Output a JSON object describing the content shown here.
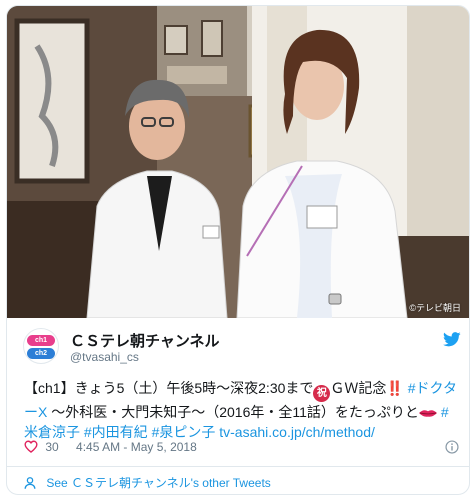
{
  "photo": {
    "watermark": "©テレビ朝日"
  },
  "avatar": {
    "top_badge": "ch1",
    "bottom_badge": "ch2"
  },
  "author": {
    "display_name": "ＣＳテレ朝チャンネル",
    "handle": "@tvasahi_cs"
  },
  "tweet": {
    "seg1": "【ch1】きょう5（土）午後5時～深夜2:30まで",
    "iwai_emoji": "祝",
    "seg2": "ＧＷ記念",
    "bang": "‼️",
    "hashtag1": "#ドクターX",
    "seg3": "～外科医・大門未知子～（2016年・全11話）をたっぷりと",
    "hashtags2": "#米倉涼子 #内田有紀 #泉ピン子",
    "link": "tv-asahi.co.jp/ch/method/"
  },
  "footer": {
    "likes": "30",
    "timestamp": "4:45 AM - May 5, 2018",
    "see_more": "See ＣＳテレ朝チャンネル's other Tweets"
  },
  "colors": {
    "link": "#1b95e0",
    "text": "#14171a",
    "muted": "#657786",
    "heart": "#e0245e",
    "border": "#e1e8ed"
  },
  "icons": [
    "twitter-bird-icon",
    "heart-icon",
    "info-icon",
    "person-icon",
    "lips-emoji",
    "iwai-emoji"
  ]
}
